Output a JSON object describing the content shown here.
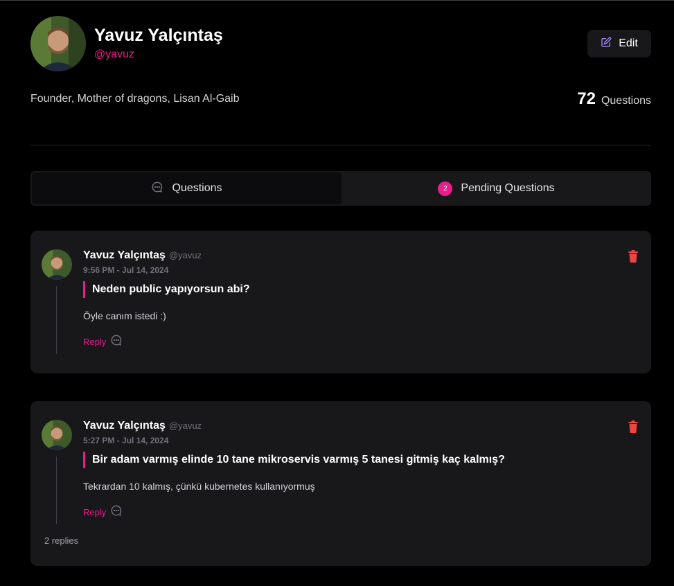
{
  "profile": {
    "name": "Yavuz Yalçıntaş",
    "handle": "@yavuz",
    "bio": "Founder, Mother of dragons, Lisan Al-Gaib",
    "question_count": "72",
    "question_count_label": "Questions",
    "edit_label": "Edit"
  },
  "tabs": [
    {
      "label": "Questions",
      "icon": "chat-bubble-icon",
      "active": true
    },
    {
      "label": "Pending Questions",
      "badge": "2",
      "active": false
    }
  ],
  "questions": [
    {
      "author": "Yavuz Yalçıntaş",
      "handle": "@yavuz",
      "time": "9:56 PM - Jul 14, 2024",
      "question": "Neden public yapıyorsun abi?",
      "answer": "Öyle canım istedi :)",
      "reply_label": "Reply",
      "replies_text": ""
    },
    {
      "author": "Yavuz Yalçıntaş",
      "handle": "@yavuz",
      "time": "5:27 PM - Jul 14, 2024",
      "question": "Bir adam varmış elinde 10 tane mikroservis varmış 5 tanesi gitmiş kaç kalmış?",
      "answer": "Tekrardan 10 kalmış, çünkü kubernetes kullanıyormuş",
      "reply_label": "Reply",
      "replies_text": "2 replies"
    }
  ],
  "colors": {
    "accent": "#e91e8c",
    "card_bg": "#18181b",
    "page_bg": "#000000",
    "delete": "#ef4444"
  }
}
